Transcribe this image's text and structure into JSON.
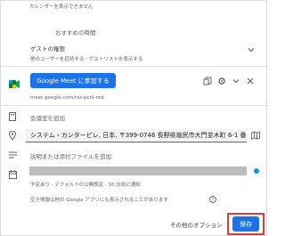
{
  "top_cut_text": "カレンダーを表示できません",
  "suggested_time": "おすすめの時間",
  "guest_permissions": {
    "title": "ゲストの権限",
    "subtitle": "他のユーザーを招待する・ゲストリストを表示する"
  },
  "meet": {
    "join_button": "Google Meet に参加する",
    "link": "meet.google.com/rsz-pcnl-nrd"
  },
  "conference_room": {
    "label": "会議室を追加"
  },
  "location": {
    "value": "システム・カンターピレ, 日本, 〒399-0746 長野県塩尻市大門並木町 6-1 番"
  },
  "description": {
    "label": "説明または添付ファイルを追加"
  },
  "calendar": {
    "meta": "予定あり · デフォルトの公開設定 · 10 分前に通知"
  },
  "availability_note": "空き情報は他の Google アプリにも表示されることがあります",
  "footer": {
    "more_options": "その他のオプション",
    "save": "保存"
  },
  "colors": {
    "primary": "#1a73e8",
    "highlight": "#e53935",
    "calendar_dot": "#039be5"
  }
}
